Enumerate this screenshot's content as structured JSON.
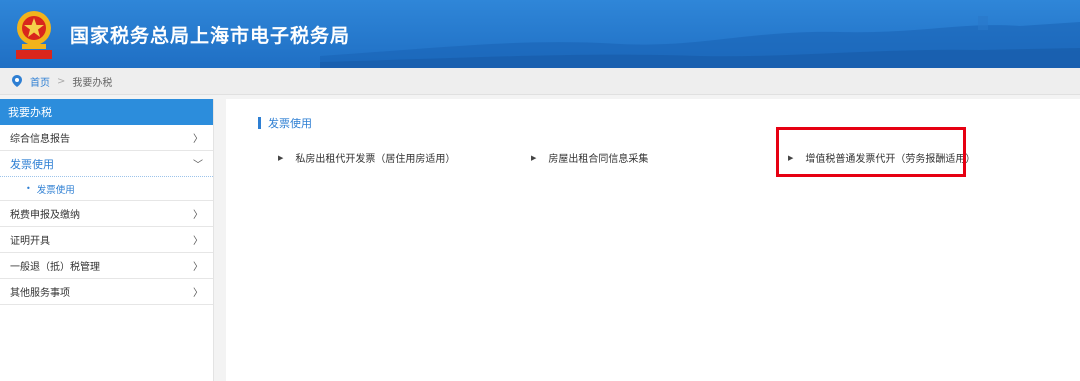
{
  "header": {
    "title": "国家税务总局上海市电子税务局"
  },
  "breadcrumb": {
    "home": "首页",
    "separator": ">",
    "current": "我要办税"
  },
  "sidebar": {
    "heading": "我要办税",
    "items": [
      {
        "label": "综合信息报告",
        "chevron": "〉",
        "active": false
      },
      {
        "label": "发票使用",
        "chevron": "﹀",
        "active": true
      },
      {
        "label": "税费申报及缴纳",
        "chevron": "〉",
        "active": false
      },
      {
        "label": "证明开具",
        "chevron": "〉",
        "active": false
      },
      {
        "label": "一般退（抵）税管理",
        "chevron": "〉",
        "active": false
      },
      {
        "label": "其他服务事项",
        "chevron": "〉",
        "active": false
      }
    ],
    "subitem": {
      "bullet": "•",
      "label": "发票使用"
    }
  },
  "main": {
    "section_title": "发票使用",
    "links": [
      {
        "label": "私房出租代开发票（居住用房适用）"
      },
      {
        "label": "房屋出租合同信息采集"
      },
      {
        "label": "增值税普通发票代开（劳务报酬适用）"
      }
    ],
    "link_bullet": "▶"
  },
  "colors": {
    "header_blue": "#1f6fc4",
    "accent": "#2e7fd3",
    "highlight": "#e60012"
  }
}
